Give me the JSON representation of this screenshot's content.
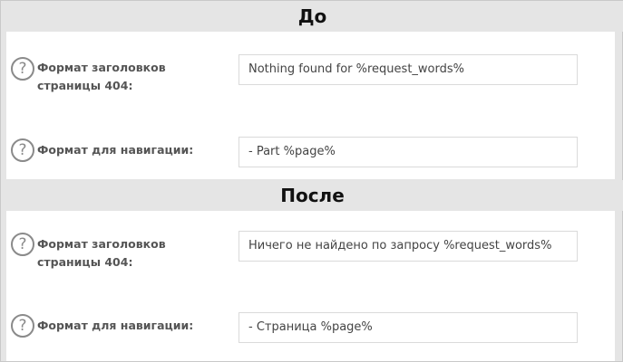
{
  "sections": [
    {
      "title": "До",
      "rows": [
        {
          "label": "Формат заголовков страницы 404:",
          "value": "Nothing found for %request_words%"
        },
        {
          "label": "Формат для навигации:",
          "value": " - Part %page%"
        }
      ]
    },
    {
      "title": "После",
      "rows": [
        {
          "label": "Формат заголовков страницы 404:",
          "value": "Ничего не найдено по запросу %request_words%"
        },
        {
          "label": "Формат для навигации:",
          "value": " - Страница %page%"
        }
      ]
    }
  ],
  "icons": {
    "help": "question-mark-circle-icon"
  },
  "colors": {
    "background": "#e5e5e5",
    "panel": "#ffffff",
    "label": "#555555"
  }
}
